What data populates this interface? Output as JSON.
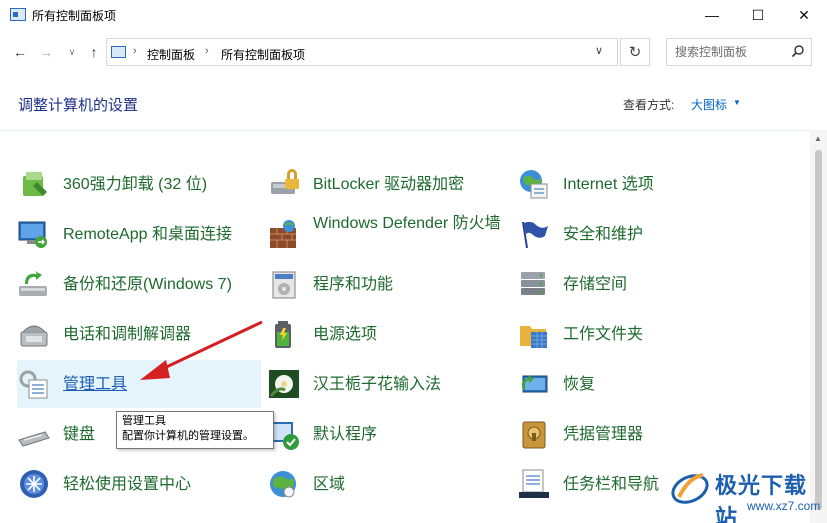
{
  "window": {
    "title": "所有控制面板项",
    "minimize": "—",
    "maximize": "☐",
    "close": "✕"
  },
  "nav": {
    "back": "←",
    "forward": "→",
    "recent": "∨",
    "up": "↑"
  },
  "address": {
    "crumbs": [
      "控制面板",
      "所有控制面板项"
    ],
    "separator": "›",
    "dropdown": "∨",
    "refresh": "↻"
  },
  "search": {
    "placeholder": "搜索控制面板"
  },
  "header": {
    "title": "调整计算机的设置",
    "view_by_label": "查看方式:",
    "view_by_value": "大图标",
    "view_by_caret": "▼"
  },
  "items": [
    {
      "label": "360强力卸载 (32 位)",
      "icon": "uninstall-icon"
    },
    {
      "label": "BitLocker 驱动器加密",
      "icon": "bitlocker-icon"
    },
    {
      "label": "Internet 选项",
      "icon": "internet-options-icon"
    },
    {
      "label": "RemoteApp 和桌面连接",
      "icon": "remoteapp-icon"
    },
    {
      "label": "Windows Defender 防火墙",
      "icon": "firewall-icon"
    },
    {
      "label": "安全和维护",
      "icon": "security-flag-icon"
    },
    {
      "label": "备份和还原(Windows 7)",
      "icon": "backup-icon"
    },
    {
      "label": "程序和功能",
      "icon": "programs-icon"
    },
    {
      "label": "存储空间",
      "icon": "storage-icon"
    },
    {
      "label": "电话和调制解调器",
      "icon": "phone-modem-icon"
    },
    {
      "label": "电源选项",
      "icon": "power-icon"
    },
    {
      "label": "工作文件夹",
      "icon": "work-folders-icon"
    },
    {
      "label": "管理工具",
      "icon": "admin-tools-icon"
    },
    {
      "label": "汉王栀子花输入法",
      "icon": "ime-flower-icon"
    },
    {
      "label": "恢复",
      "icon": "recovery-icon"
    },
    {
      "label": "键盘",
      "icon": "keyboard-icon"
    },
    {
      "label": "默认程序",
      "icon": "default-programs-icon"
    },
    {
      "label": "凭据管理器",
      "icon": "credential-icon"
    },
    {
      "label": "轻松使用设置中心",
      "icon": "ease-of-access-icon"
    },
    {
      "label": "区域",
      "icon": "region-icon"
    },
    {
      "label": "任务栏和导航",
      "icon": "taskbar-icon"
    }
  ],
  "tooltip": {
    "title": "管理工具",
    "description": "配置你计算机的管理设置。"
  },
  "watermark": {
    "name": "极光下载站",
    "url": "www.xz7.com"
  },
  "colors": {
    "item_text": "#1e6a2e",
    "heading": "#1e3287",
    "link": "#0066cc",
    "hover_bg": "#e5f3fb",
    "arrow": "#d42020"
  }
}
